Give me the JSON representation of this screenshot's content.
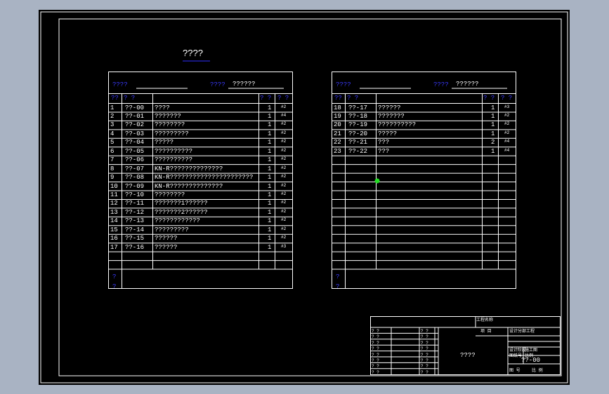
{
  "drawing": {
    "heading": "????",
    "green_marker_color": "#22dd22",
    "frame_color": "#ffffff",
    "line_color": "#ffffff",
    "accent_color": "#3030ff"
  },
  "left_table": {
    "header_left": "????",
    "header_mid": "????",
    "header_value": "??????",
    "col_headers": [
      "??",
      "?  ?",
      "",
      "? ?",
      "? ?"
    ],
    "rows": [
      {
        "no": "1",
        "code": "??-00",
        "name": "????",
        "qty": "1",
        "mat": "#2"
      },
      {
        "no": "2",
        "code": "??-01",
        "name": "???????",
        "qty": "1",
        "mat": "#4"
      },
      {
        "no": "3",
        "code": "??-02",
        "name": "????????",
        "qty": "1",
        "mat": "#2"
      },
      {
        "no": "4",
        "code": "??-03",
        "name": "?????????",
        "qty": "1",
        "mat": "#2"
      },
      {
        "no": "5",
        "code": "??-04",
        "name": "?????",
        "qty": "1",
        "mat": "#2"
      },
      {
        "no": "6",
        "code": "??-05",
        "name": "??????????",
        "qty": "1",
        "mat": "#2"
      },
      {
        "no": "7",
        "code": "??-06",
        "name": "??????????",
        "qty": "1",
        "mat": "#2"
      },
      {
        "no": "8",
        "code": "??-07",
        "name": "KN-R??????????????",
        "qty": "1",
        "mat": "#2"
      },
      {
        "no": "9",
        "code": "??-08",
        "name": "KN-R??????????????????????",
        "qty": "1",
        "mat": "#2"
      },
      {
        "no": "10",
        "code": "??-09",
        "name": "KN-R??????????????",
        "qty": "1",
        "mat": "#2"
      },
      {
        "no": "11",
        "code": "??-10",
        "name": "????????",
        "qty": "1",
        "mat": "#2"
      },
      {
        "no": "12",
        "code": "??-11",
        "name": "???????1??????",
        "qty": "1",
        "mat": "#2"
      },
      {
        "no": "13",
        "code": "??-12",
        "name": "???????2??????",
        "qty": "1",
        "mat": "#2"
      },
      {
        "no": "14",
        "code": "??-13",
        "name": "????????????",
        "qty": "1",
        "mat": "#2"
      },
      {
        "no": "15",
        "code": "??-14",
        "name": "?????????",
        "qty": "1",
        "mat": "#2"
      },
      {
        "no": "16",
        "code": "??-15",
        "name": "??????",
        "qty": "1",
        "mat": "#2"
      },
      {
        "no": "17",
        "code": "??-16",
        "name": "??????",
        "qty": "1",
        "mat": "#3"
      }
    ],
    "note": [
      "?",
      "?"
    ]
  },
  "right_table": {
    "header_left": "????",
    "header_mid": "????",
    "header_value": "??????",
    "col_headers": [
      "??",
      "?  ?",
      "",
      "? ?",
      "? ?"
    ],
    "rows": [
      {
        "no": "18",
        "code": "??-17",
        "name": "??????",
        "qty": "1",
        "mat": "#3"
      },
      {
        "no": "19",
        "code": "??-18",
        "name": "???????",
        "qty": "1",
        "mat": "#2"
      },
      {
        "no": "20",
        "code": "??-19",
        "name": "??????????",
        "qty": "1",
        "mat": "#2"
      },
      {
        "no": "21",
        "code": "??-20",
        "name": "?????",
        "qty": "1",
        "mat": "#2"
      },
      {
        "no": "22",
        "code": "??-21",
        "name": "???",
        "qty": "2",
        "mat": "#4"
      },
      {
        "no": "23",
        "code": "??-22",
        "name": "???",
        "qty": "1",
        "mat": "#4"
      }
    ],
    "note": [
      "?",
      "?"
    ]
  },
  "title_block": {
    "company": "工程名称",
    "project_label": "项  目",
    "project_value": "设计分部工程",
    "center_title": "????",
    "drawing_no": "??-00",
    "left_labels": [
      "?  ?",
      "?  ?",
      "?  ?",
      "?  ?",
      "?  ?",
      "?  ?",
      "?  ?",
      "?  ?"
    ],
    "right_small": [
      "设计阶段",
      "施工图",
      "图纸号",
      "比例",
      "图 号",
      "比  例"
    ]
  }
}
